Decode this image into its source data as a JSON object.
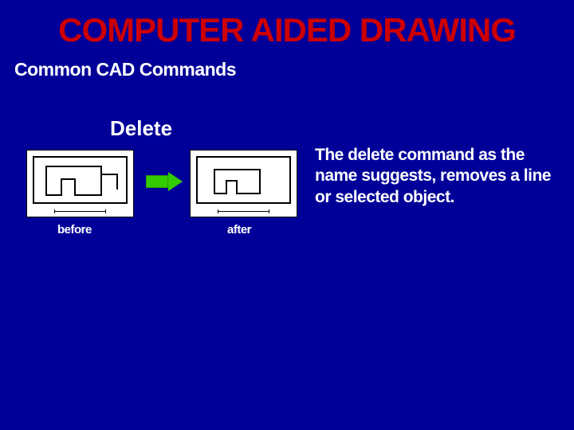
{
  "title": "COMPUTER AIDED DRAWING",
  "subtitle": "Common CAD Commands",
  "command": {
    "name": "Delete",
    "description": "The delete command as the name suggests, removes a line or selected object.",
    "before_label": "before",
    "after_label": "after"
  }
}
